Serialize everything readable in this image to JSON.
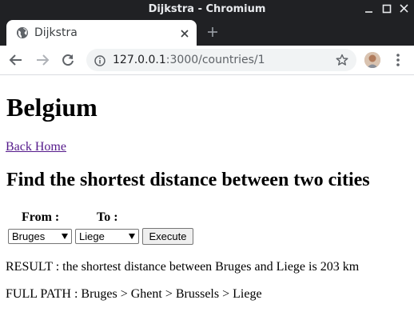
{
  "window": {
    "title": "Dijkstra - Chromium",
    "background": "#202124"
  },
  "tabs": [
    {
      "label": "Dijkstra",
      "active": true
    }
  ],
  "toolbar": {
    "url_host": "127.0.0.1",
    "url_path": ":3000/countries/1"
  },
  "page": {
    "heading": "Belgium",
    "back_link": "Back Home",
    "subheading": "Find the shortest distance between two cities",
    "form": {
      "from_label": "From :",
      "to_label": "To :",
      "from_value": "Bruges",
      "to_value": "Liege",
      "execute_label": "Execute"
    },
    "result": "RESULT : the shortest distance between Bruges and Liege is 203 km",
    "full_path": "FULL PATH : Bruges > Ghent > Brussels > Liege",
    "link_color": "#551a8b"
  }
}
